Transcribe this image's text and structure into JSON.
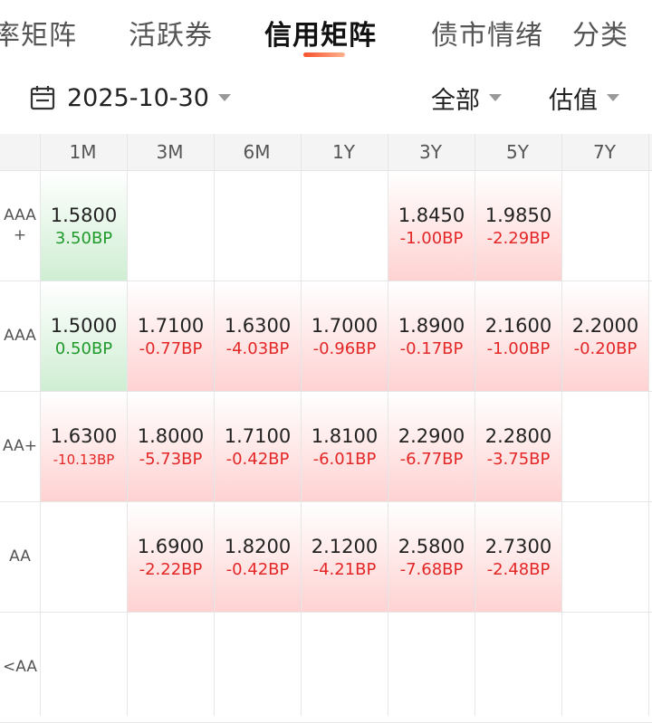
{
  "tabs": [
    {
      "label": "率矩阵",
      "active": false
    },
    {
      "label": "活跃券",
      "active": false
    },
    {
      "label": "信用矩阵",
      "active": true
    },
    {
      "label": "债市情绪",
      "active": false
    },
    {
      "label": "分类",
      "active": false
    }
  ],
  "filter": {
    "date": "2025-10-30",
    "scope": "全部",
    "metric": "估值",
    "icons": {
      "date": "calendar-icon",
      "dropdown": "caret-down-icon"
    }
  },
  "colors": {
    "up": "#e32626",
    "down": "#1f9a2a",
    "accent": "#f6502a"
  },
  "matrix": {
    "columns": [
      "1M",
      "3M",
      "6M",
      "1Y",
      "3Y",
      "5Y",
      "7Y"
    ],
    "rows": [
      {
        "rating": "AAA +",
        "cells": [
          {
            "value": "1.5800",
            "change": "3.50BP",
            "dir": "down"
          },
          null,
          null,
          null,
          {
            "value": "1.8450",
            "change": "-1.00BP",
            "dir": "up"
          },
          {
            "value": "1.9850",
            "change": "-2.29BP",
            "dir": "up"
          },
          null
        ]
      },
      {
        "rating": "AAA",
        "cells": [
          {
            "value": "1.5000",
            "change": "0.50BP",
            "dir": "down"
          },
          {
            "value": "1.7100",
            "change": "-0.77BP",
            "dir": "up"
          },
          {
            "value": "1.6300",
            "change": "-4.03BP",
            "dir": "up"
          },
          {
            "value": "1.7000",
            "change": "-0.96BP",
            "dir": "up"
          },
          {
            "value": "1.8900",
            "change": "-0.17BP",
            "dir": "up"
          },
          {
            "value": "2.1600",
            "change": "-1.00BP",
            "dir": "up"
          },
          {
            "value": "2.2000",
            "change": "-0.20BP",
            "dir": "up"
          }
        ]
      },
      {
        "rating": "AA+",
        "cells": [
          {
            "value": "1.6300",
            "change": "-10.13BP",
            "dir": "up"
          },
          {
            "value": "1.8000",
            "change": "-5.73BP",
            "dir": "up"
          },
          {
            "value": "1.7100",
            "change": "-0.42BP",
            "dir": "up"
          },
          {
            "value": "1.8100",
            "change": "-6.01BP",
            "dir": "up"
          },
          {
            "value": "2.2900",
            "change": "-6.77BP",
            "dir": "up"
          },
          {
            "value": "2.2800",
            "change": "-3.75BP",
            "dir": "up"
          },
          null
        ]
      },
      {
        "rating": "AA",
        "cells": [
          null,
          {
            "value": "1.6900",
            "change": "-2.22BP",
            "dir": "up"
          },
          {
            "value": "1.8200",
            "change": "-0.42BP",
            "dir": "up"
          },
          {
            "value": "2.1200",
            "change": "-4.21BP",
            "dir": "up"
          },
          {
            "value": "2.5800",
            "change": "-7.68BP",
            "dir": "up"
          },
          {
            "value": "2.7300",
            "change": "-2.48BP",
            "dir": "up"
          },
          null
        ]
      },
      {
        "rating": "<AA",
        "cells": [
          null,
          null,
          null,
          null,
          null,
          null,
          null
        ]
      }
    ]
  }
}
